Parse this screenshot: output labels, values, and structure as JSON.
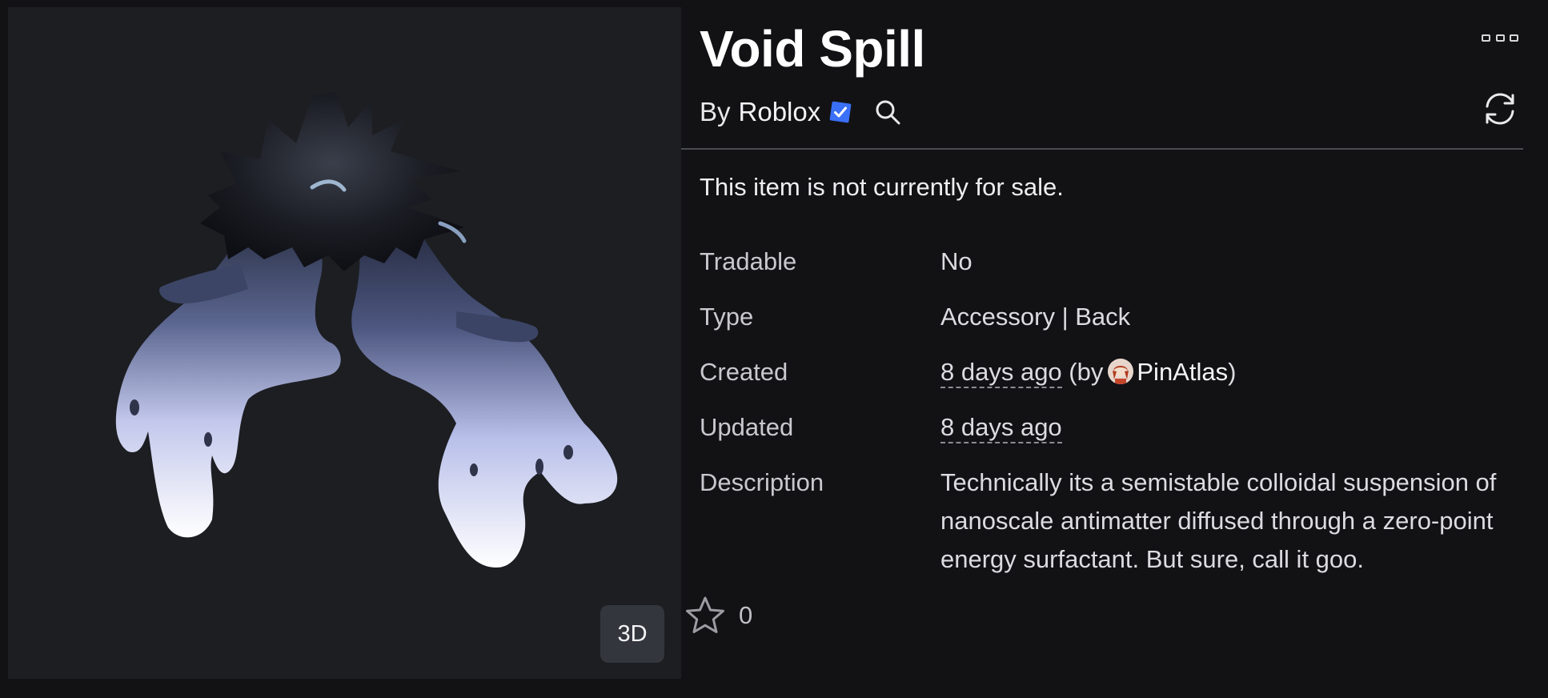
{
  "item": {
    "name": "Void Spill",
    "by_prefix": "By",
    "creator": "Roblox",
    "sale_status": "This item is not currently for sale.",
    "preview_toggle_label": "3D"
  },
  "details": {
    "tradable": {
      "label": "Tradable",
      "value": "No"
    },
    "type": {
      "label": "Type",
      "value": "Accessory | Back"
    },
    "created": {
      "label": "Created",
      "value": "8 days ago",
      "by_open": "(by",
      "user": "PinAtlas",
      "by_close": ")"
    },
    "updated": {
      "label": "Updated",
      "value": "8 days ago"
    },
    "description": {
      "label": "Description",
      "value": "Technically its a semistable colloidal suspension of nanoscale antimatter diffused through a zero-point energy surfactant. But sure, call it goo."
    }
  },
  "favorites": {
    "count": "0"
  },
  "icons": {
    "verified": "verified-badge-icon",
    "search": "search-icon",
    "more": "more-options-icon",
    "refresh": "refresh-icon",
    "favorite": "star-icon"
  },
  "colors": {
    "background": "#121215",
    "preview_background": "#1c1e22",
    "verified_blue": "#3a6ff7",
    "divider": "#4a4c52"
  }
}
